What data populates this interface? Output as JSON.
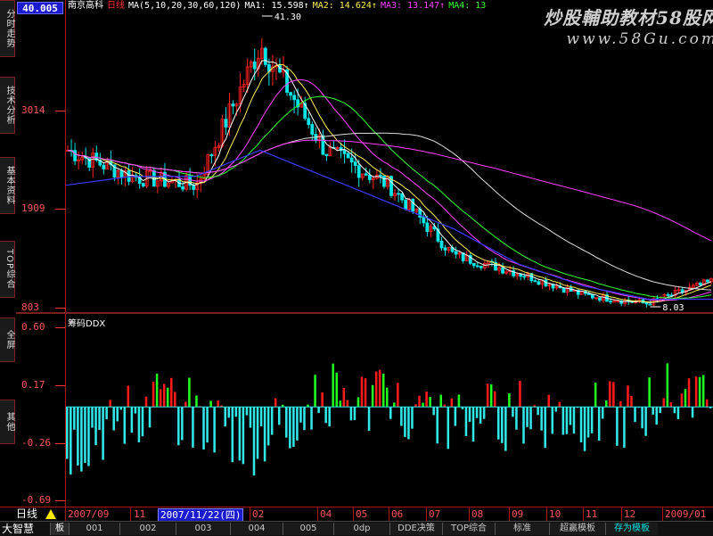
{
  "header": {
    "stock_name": "南京高科",
    "period": "日线",
    "ma_def": "MA(5,10,20,30,60,120)",
    "ma1": "MA1: 15.598↑",
    "ma2": "MA2: 14.624↑",
    "ma3": "MA3: 13.147↑",
    "ma4": "MA4: 13"
  },
  "watermark": {
    "line1": "炒股輔助教材58股网",
    "line2": "www.58Gu.com"
  },
  "price_axis": {
    "top_value": "40.005",
    "labels": [
      "3014",
      "1909",
      "803"
    ]
  },
  "price_annotations": {
    "high": "41.30",
    "low": "8.03"
  },
  "ddx": {
    "title": "筹码DDX",
    "labels": [
      "0.60",
      "0.17",
      "-0.26",
      "-0.69"
    ]
  },
  "side_tabs": [
    "分时走势",
    "技术分析",
    "基本资料",
    "TOP综合",
    "全屏",
    "其他"
  ],
  "bottom_axis": {
    "period_label": "日线",
    "months": [
      "2007/09",
      "11",
      "02",
      "04",
      "05",
      "06",
      "07",
      "08",
      "09",
      "10",
      "11",
      "12",
      "2009/01"
    ],
    "cursor_date": "2007/11/22(四)"
  },
  "tabs_bar": {
    "app_name": "大智慧",
    "tabs": [
      "板",
      "001",
      "002",
      "003",
      "004",
      "005",
      "0dp",
      "DDE决策",
      "TOP综合",
      "标准",
      "超赢模板",
      "存为模板"
    ]
  },
  "colors": {
    "up": "#ff2020",
    "down": "#00e5e5",
    "axis": "#ff5555",
    "ddx_up": "#ff1a1a",
    "ddx_green": "#20ff20",
    "ddx_down": "#30e8e8"
  },
  "chart_data": [
    {
      "type": "line",
      "ylim": [
        8.03,
        41.3
      ],
      "x": [
        0,
        10,
        20,
        30,
        40,
        50,
        60,
        70,
        80,
        90,
        100
      ],
      "series": [
        {
          "values": [
            26,
            23,
            22,
            38,
            26,
            22,
            14,
            12,
            9.5,
            8.5,
            11
          ]
        },
        {
          "values": [
            24,
            23,
            22,
            27,
            24,
            20,
            14,
            12,
            10,
            9,
            9.5
          ]
        },
        {
          "values": [
            22,
            23,
            23,
            26,
            23,
            20,
            17,
            13,
            10.5,
            9,
            9
          ]
        }
      ]
    },
    {
      "type": "bar",
      "ylim": [
        -0.69,
        0.6
      ],
      "categories": [
        "Oct",
        "Dec",
        "Feb",
        "Apr",
        "Jun",
        "Aug",
        "Oct",
        "Dec"
      ],
      "values": [
        -0.3,
        0.05,
        -0.25,
        0.1,
        -0.1,
        -0.05,
        -0.08,
        0.2
      ]
    }
  ]
}
